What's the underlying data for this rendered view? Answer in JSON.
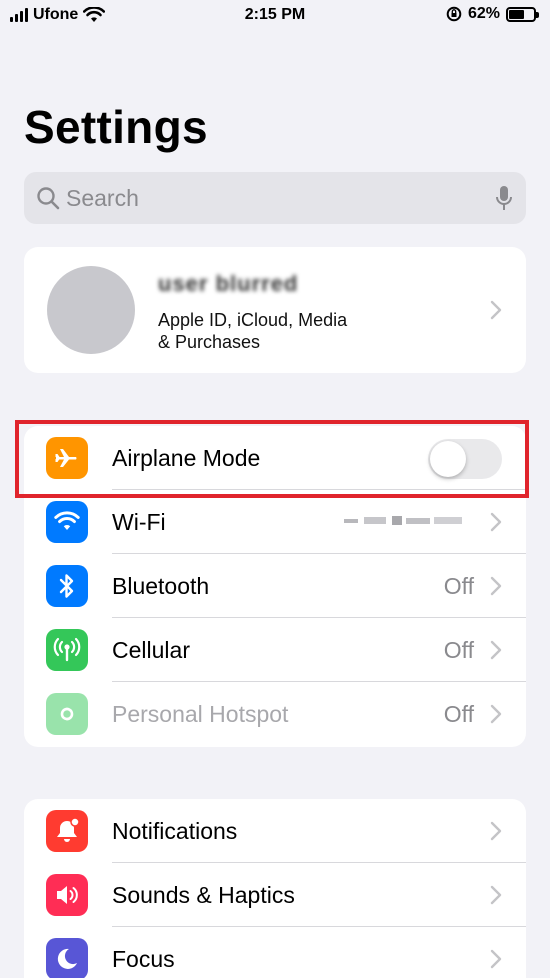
{
  "status_bar": {
    "carrier": "Ufone",
    "time": "2:15 PM",
    "battery_percent": "62%",
    "battery_level": 0.62
  },
  "page": {
    "title": "Settings"
  },
  "search": {
    "placeholder": "Search"
  },
  "profile": {
    "name": "user blurred",
    "subtitle_line1": "Apple ID, iCloud, Media",
    "subtitle_line2": "& Purchases"
  },
  "connectivity": [
    {
      "label": "Airplane Mode",
      "icon": "airplane-icon",
      "color": "#ff9500",
      "toggle": false
    },
    {
      "label": "Wi-Fi",
      "icon": "wifi-icon",
      "color": "#007aff",
      "value": ""
    },
    {
      "label": "Bluetooth",
      "icon": "bluetooth-icon",
      "color": "#007aff",
      "value": "Off"
    },
    {
      "label": "Cellular",
      "icon": "cellular-icon",
      "color": "#34c759",
      "value": "Off"
    },
    {
      "label": "Personal Hotspot",
      "icon": "hotspot-icon",
      "color": "#34c759",
      "value": "Off",
      "disabled": true
    }
  ],
  "general": [
    {
      "label": "Notifications",
      "icon": "notifications-icon",
      "color": "#ff3b30"
    },
    {
      "label": "Sounds & Haptics",
      "icon": "sounds-icon",
      "color": "#ff2d55"
    },
    {
      "label": "Focus",
      "icon": "focus-icon",
      "color": "#5856d6"
    }
  ],
  "colors": {
    "highlight": "#e0242c",
    "background": "#f2f2f7"
  }
}
